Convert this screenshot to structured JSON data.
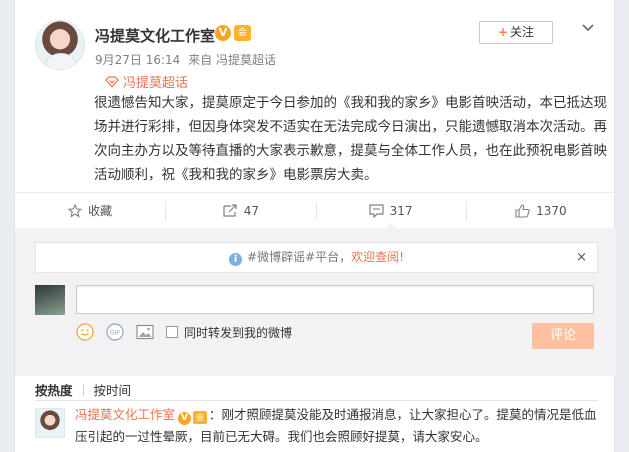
{
  "post": {
    "author": "冯提莫文化工作室",
    "verified_badge": "V",
    "member_badge": "会",
    "date": "9月27日 16:14",
    "source": "来自 冯提莫超话",
    "follow_label": "关注",
    "topic": "冯提莫超话",
    "content": "很遗憾告知大家，提莫原定于今日参加的《我和我的家乡》电影首映活动，本已抵达现场并进行彩排，但因身体突发不适实在无法完成今日演出，只能遗憾取消本次活动。再次向主办方以及等待直播的大家表示歉意，提莫与全体工作人员，也在此预祝电影首映活动顺利，祝《我和我的家乡》电影票房大卖。"
  },
  "actions": {
    "favorite_label": "收藏",
    "repost_count": "47",
    "comment_count": "317",
    "like_count": "1370"
  },
  "comment_box": {
    "notice_text": "#微博辟谣#平台，",
    "notice_link": "欢迎查阅!",
    "close_glyph": "×",
    "input_value": "",
    "repost_checkbox_label": "同时转发到我的微博",
    "submit_label": "评论"
  },
  "sort": {
    "hot_label": "按热度",
    "time_label": "按时间"
  },
  "comments": [
    {
      "author": "冯提莫文化工作室",
      "verified_badge": "V",
      "member_badge": "会",
      "text": "：刚才照顾提莫没能及时通报消息，让大家担心了。提莫的情况是低血压引起的一过性晕厥，目前已无大碍。我们也会照顾好提莫，请大家安心。"
    }
  ],
  "colors": {
    "accent": "#eb7350",
    "verified": "#f7a522",
    "submit_disabled": "#ffc09f",
    "page_bg": "#e9edf2"
  },
  "icons": {
    "favorite": "star-icon",
    "repost": "repost-icon",
    "comment": "comment-icon",
    "like": "thumbs-up-icon",
    "topic": "diamond-topic-icon",
    "more": "chevron-down-icon",
    "emoji": "smiley-icon",
    "gif": "gif-icon",
    "image": "image-icon",
    "notice": "info-icon"
  }
}
